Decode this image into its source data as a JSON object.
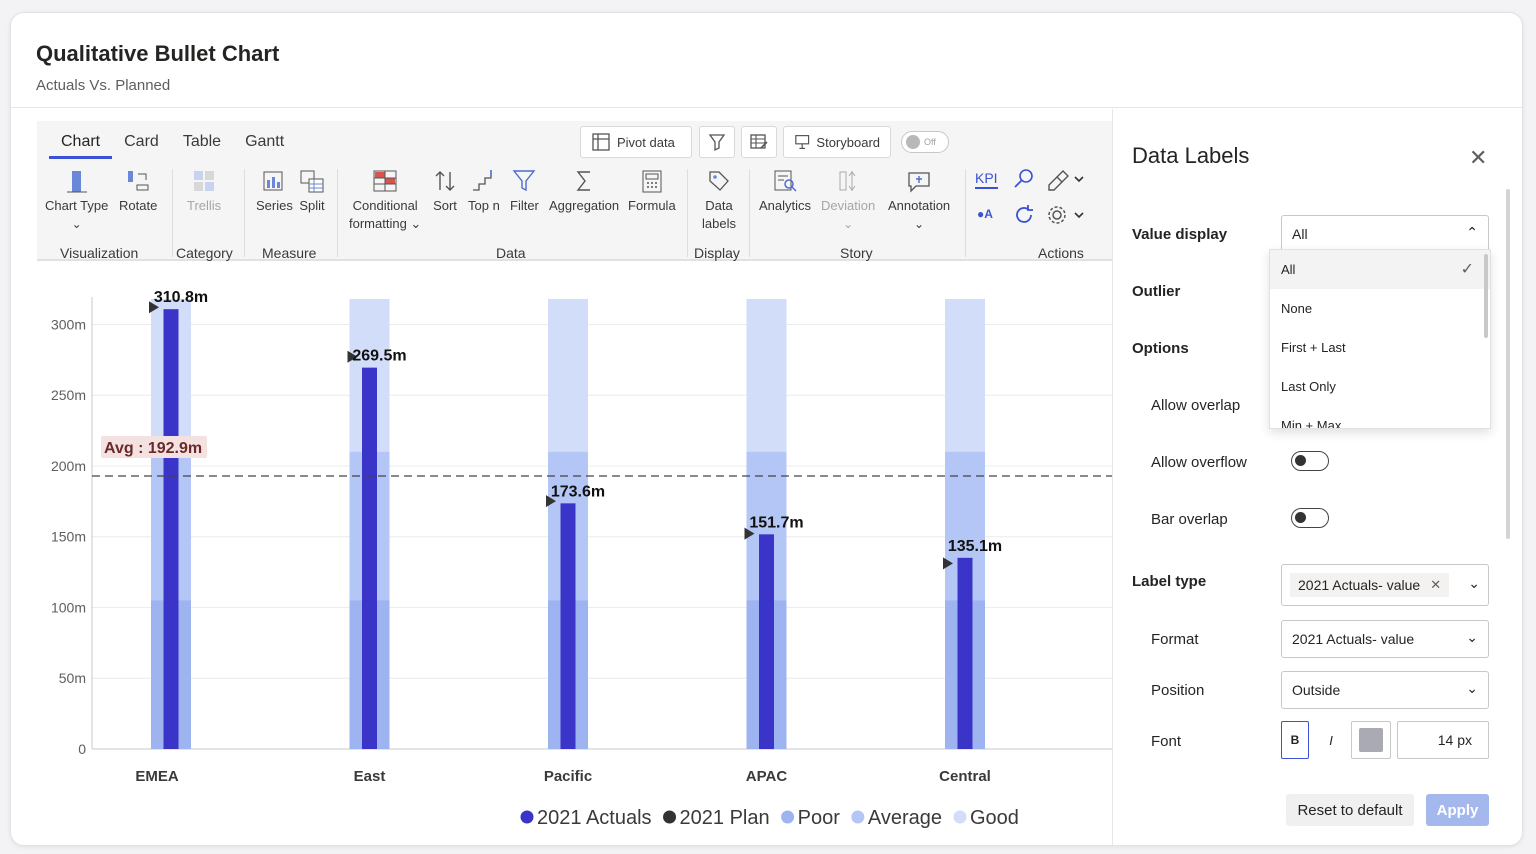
{
  "header": {
    "title": "Qualitative Bullet Chart",
    "subtitle": "Actuals Vs. Planned"
  },
  "toolbar": {
    "tabs": [
      "Chart",
      "Card",
      "Table",
      "Gantt"
    ],
    "top_buttons": {
      "pivot": "Pivot data",
      "storyboard": "Storyboard",
      "toggle": "Off"
    },
    "tools": {
      "chart_type": "Chart Type",
      "rotate": "Rotate",
      "trellis": "Trellis",
      "series": "Series",
      "split": "Split",
      "cond_fmt_1": "Conditional",
      "cond_fmt_2": "formatting",
      "sort": "Sort",
      "topn": "Top n",
      "filter": "Filter",
      "aggregation": "Aggregation",
      "formula": "Formula",
      "data_labels_1": "Data",
      "data_labels_2": "labels",
      "analytics": "Analytics",
      "deviation": "Deviation",
      "annotation": "Annotation",
      "kpi": "KPI"
    },
    "groups": {
      "visualization": "Visualization",
      "category": "Category",
      "measure": "Measure",
      "data": "Data",
      "display": "Display",
      "story": "Story",
      "actions": "Actions"
    }
  },
  "chart_data": {
    "type": "bar",
    "subtype": "qualitative bullet",
    "categories": [
      "EMEA",
      "East",
      "Pacific",
      "APAC",
      "Central"
    ],
    "series": [
      {
        "name": "2021 Actuals",
        "values": [
          310.8,
          269.5,
          173.6,
          151.7,
          135.1
        ],
        "color": "#3a35c8"
      },
      {
        "name": "2021 Plan",
        "values": [
          315,
          280,
          178,
          155,
          134
        ],
        "color": "#333333"
      }
    ],
    "bands": [
      {
        "name": "Poor",
        "value": 105,
        "color": "#9db4f0"
      },
      {
        "name": "Average",
        "value": 210,
        "color": "#b3c6f5"
      },
      {
        "name": "Good",
        "value": 318,
        "color": "#d1ddf9"
      }
    ],
    "data_labels": [
      "310.8m",
      "269.5m",
      "173.6m",
      "151.7m",
      "135.1m"
    ],
    "average": {
      "label": "Avg : 192.9m",
      "value": 192.9
    },
    "yticks": [
      "0",
      "50m",
      "100m",
      "150m",
      "200m",
      "250m",
      "300m"
    ],
    "ylim": [
      0,
      318
    ],
    "legend": [
      {
        "name": "2021 Actuals",
        "color": "#3a35c8"
      },
      {
        "name": "2021 Plan",
        "color": "#333333"
      },
      {
        "name": "Poor",
        "color": "#9db4f0"
      },
      {
        "name": "Average",
        "color": "#b3c6f5"
      },
      {
        "name": "Good",
        "color": "#d1ddf9"
      }
    ],
    "legend_position": "bottom",
    "grid": true
  },
  "panel": {
    "title": "Data Labels",
    "value_display_label": "Value display",
    "value_display": "All",
    "dropdown_options": [
      "All",
      "None",
      "First + Last",
      "Last Only",
      "Min + Max"
    ],
    "outlier": "Outlier",
    "options": "Options",
    "allow_overlap": "Allow overlap",
    "allow_overflow": "Allow overflow",
    "bar_overlap": "Bar overlap",
    "label_type_label": "Label type",
    "label_type_tag": "2021 Actuals- value",
    "format_label": "Format",
    "format_value": "2021 Actuals- value",
    "position_label": "Position",
    "position_value": "Outside",
    "font_label": "Font",
    "font_bold": "B",
    "font_italic": "I",
    "font_size": "14 px",
    "font_color": "#a9aab3",
    "reset": "Reset to default",
    "apply": "Apply"
  }
}
